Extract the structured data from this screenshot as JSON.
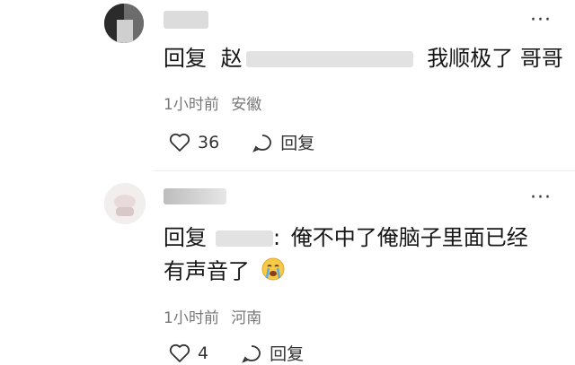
{
  "comments": [
    {
      "reply_prefix": "回复",
      "reply_name_visible": "赵",
      "reply_text": "我顺极了 哥哥",
      "time": "1小时前",
      "location": "安徽",
      "likes": "36",
      "reply_action": "回复"
    },
    {
      "reply_prefix": "回复",
      "reply_separator": ":",
      "reply_text_line1": "俺不中了俺脑子里面已经",
      "reply_text_line2": "有声音了",
      "time": "1小时前",
      "location": "河南",
      "likes": "4",
      "reply_action": "回复"
    }
  ],
  "icons": {
    "more": "more-dots-icon",
    "like": "heart-icon",
    "reply": "comment-bubble-icon",
    "emoji": "crying-face-icon"
  }
}
